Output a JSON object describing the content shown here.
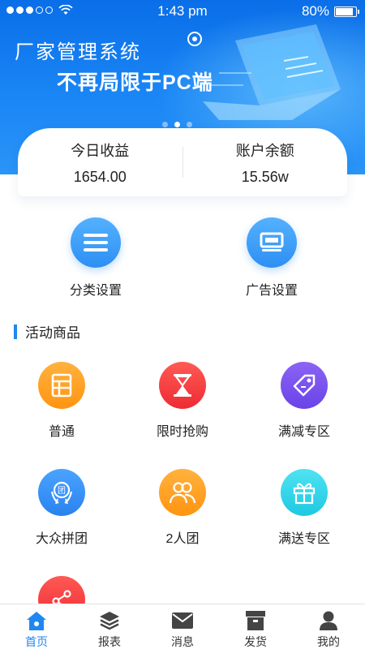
{
  "status_bar": {
    "time": "1:43 pm",
    "battery": "80%",
    "battery_level": 0.8
  },
  "banner": {
    "title": "厂家管理系统",
    "subtitle": "不再局限于PC端",
    "page_index": 2,
    "page_count": 3
  },
  "stats": [
    {
      "label": "今日收益",
      "value": "1654.00"
    },
    {
      "label": "账户余额",
      "value": "15.56w"
    }
  ],
  "settings": [
    {
      "label": "分类设置",
      "icon": "menu-list-icon"
    },
    {
      "label": "广告设置",
      "icon": "monitor-icon"
    }
  ],
  "section": {
    "title": "活动商品"
  },
  "activities": [
    {
      "label": "普通",
      "icon": "grid-doc-icon",
      "color": "#ff9f22"
    },
    {
      "label": "限时抢购",
      "icon": "hourglass-icon",
      "color": "#f2333a"
    },
    {
      "label": "满减专区",
      "icon": "price-tag-icon",
      "color": "#7750ef"
    },
    {
      "label": "大众拼团",
      "icon": "group-badge-icon",
      "color": "#3590f4"
    },
    {
      "label": "2人团",
      "icon": "two-people-icon",
      "color": "#ffa01e"
    },
    {
      "label": "满送专区",
      "icon": "gift-icon",
      "color": "#2fd3e8"
    },
    {
      "label": "",
      "icon": "share-icon",
      "color": "#f2333a"
    }
  ],
  "tabbar": [
    {
      "label": "首页",
      "icon": "home-icon",
      "active": true
    },
    {
      "label": "报表",
      "icon": "layers-icon",
      "active": false
    },
    {
      "label": "消息",
      "icon": "mail-icon",
      "active": false
    },
    {
      "label": "发货",
      "icon": "box-icon",
      "active": false
    },
    {
      "label": "我的",
      "icon": "user-icon",
      "active": false
    }
  ],
  "colors": {
    "primary": "#1e88f0",
    "banner_top": "#0a6ee8",
    "banner_bottom": "#2a94f7"
  }
}
